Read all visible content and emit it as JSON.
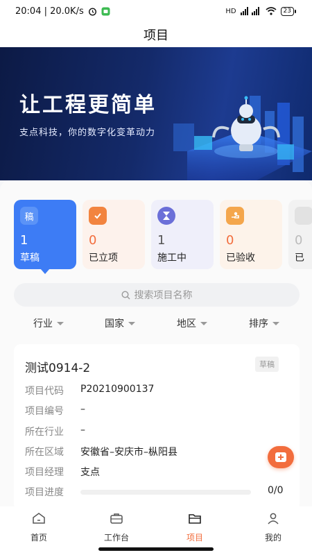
{
  "status_bar": {
    "time_net": "20:04 | 20.0K/s",
    "signal_label": "HD",
    "battery": "23"
  },
  "nav": {
    "title": "项目"
  },
  "banner": {
    "title": "让工程更简单",
    "subtitle": "支点科技，你的数字化变革动力"
  },
  "status_cards": [
    {
      "icon_char": "稿",
      "icon": "draft-icon",
      "count": "1",
      "label": "草稿"
    },
    {
      "icon": "clipboard-check-icon",
      "count": "0",
      "label": "已立项"
    },
    {
      "icon": "hourglass-icon",
      "count": "1",
      "label": "施工中"
    },
    {
      "icon": "accepted-hand-icon",
      "count": "0",
      "label": "已验收"
    },
    {
      "count": "0",
      "label": "已"
    }
  ],
  "search": {
    "placeholder": "搜索项目名称"
  },
  "filters": [
    "行业",
    "国家",
    "地区",
    "排序"
  ],
  "project": {
    "name": "测试0914-2",
    "status": "草稿",
    "fields": [
      {
        "key": "项目代码",
        "value": "P20210900137"
      },
      {
        "key": "项目编号",
        "value": "–"
      },
      {
        "key": "所在行业",
        "value": "–"
      },
      {
        "key": "所在区域",
        "value": "安徽省–安庆市–枞阳县"
      },
      {
        "key": "项目经理",
        "value": "支点"
      },
      {
        "key": "项目进度",
        "value": ""
      }
    ],
    "progress_text": "0/0",
    "progress_fraction": 0
  },
  "tabs": [
    {
      "label": "首页",
      "icon": "home-icon"
    },
    {
      "label": "工作台",
      "icon": "briefcase-icon"
    },
    {
      "label": "项目",
      "icon": "folder-icon"
    },
    {
      "label": "我的",
      "icon": "user-icon"
    }
  ],
  "colors": {
    "accent": "#3d7cf5",
    "orange": "#f26d3d"
  }
}
